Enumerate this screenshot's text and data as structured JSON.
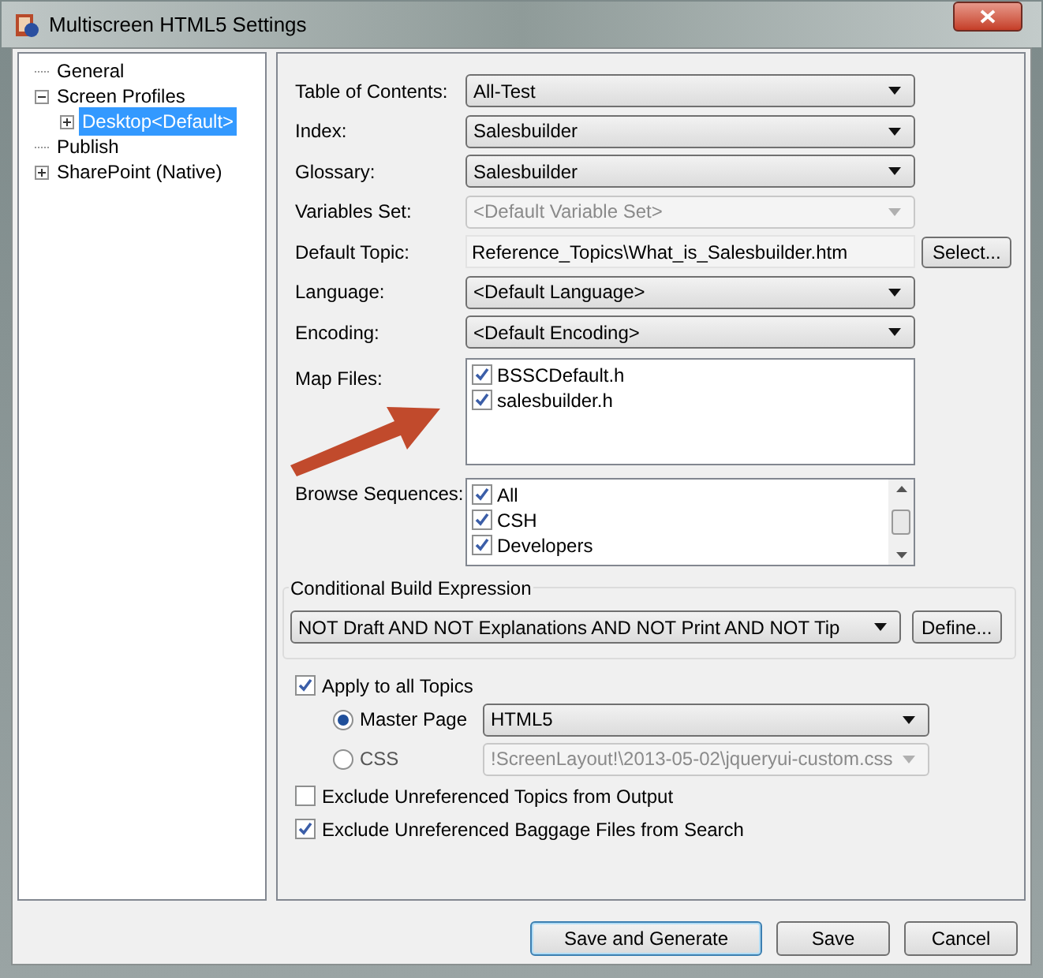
{
  "window": {
    "title": "Multiscreen HTML5 Settings"
  },
  "tree": [
    {
      "label": "General",
      "selected": false
    },
    {
      "label": "Screen Profiles",
      "selected": false,
      "expanded": true,
      "children": [
        {
          "label": "Desktop<Default>",
          "selected": true,
          "expanded": false
        }
      ]
    },
    {
      "label": "Publish",
      "selected": false
    },
    {
      "label": "SharePoint (Native)",
      "selected": false,
      "expanded": false
    }
  ],
  "fields": [
    {
      "kind": "dropdown",
      "label": "Table of Contents:",
      "value": "All-Test",
      "disabled": false
    },
    {
      "kind": "dropdown",
      "label": "Index:",
      "value": "Salesbuilder",
      "disabled": false
    },
    {
      "kind": "dropdown",
      "label": "Glossary:",
      "value": "Salesbuilder",
      "disabled": false
    },
    {
      "kind": "dropdown",
      "label": "Variables Set:",
      "value": "<Default Variable Set>",
      "disabled": true
    },
    {
      "kind": "text",
      "label": "Default Topic:",
      "value": "Reference_Topics\\What_is_Salesbuilder.htm",
      "button": "Select..."
    },
    {
      "kind": "dropdown",
      "label": "Language:",
      "value": "<Default Language>",
      "disabled": false
    },
    {
      "kind": "dropdown",
      "label": "Encoding:",
      "value": "<Default Encoding>",
      "disabled": false
    }
  ],
  "map_files": {
    "label": "Map Files:",
    "items": [
      {
        "label": "BSSCDefault.h",
        "checked": true
      },
      {
        "label": "salesbuilder.h",
        "checked": true
      }
    ]
  },
  "browse_sequences": {
    "label": "Browse Sequences:",
    "items": [
      {
        "label": "All",
        "checked": true
      },
      {
        "label": "CSH",
        "checked": true
      },
      {
        "label": "Developers",
        "checked": true
      }
    ]
  },
  "conditional_build": {
    "title": "Conditional Build Expression",
    "value": "NOT Draft AND NOT Explanations AND NOT Print AND NOT Tip",
    "button": "Define..."
  },
  "apply_to_all": {
    "label": "Apply to all Topics",
    "checked": true
  },
  "style_options": [
    {
      "label": "Master Page",
      "selected": true,
      "value": "HTML5",
      "disabled": false
    },
    {
      "label": "CSS",
      "selected": false,
      "value": "!ScreenLayout!\\2013-05-02\\jqueryui-custom.css",
      "disabled": true
    }
  ],
  "excludes": [
    {
      "label": "Exclude Unreferenced Topics from Output",
      "checked": false
    },
    {
      "label": "Exclude Unreferenced Baggage Files from Search",
      "checked": true
    }
  ],
  "buttons": [
    {
      "label": "Save and Generate",
      "default": true
    },
    {
      "label": "Save",
      "default": false
    },
    {
      "label": "Cancel",
      "default": false
    }
  ]
}
